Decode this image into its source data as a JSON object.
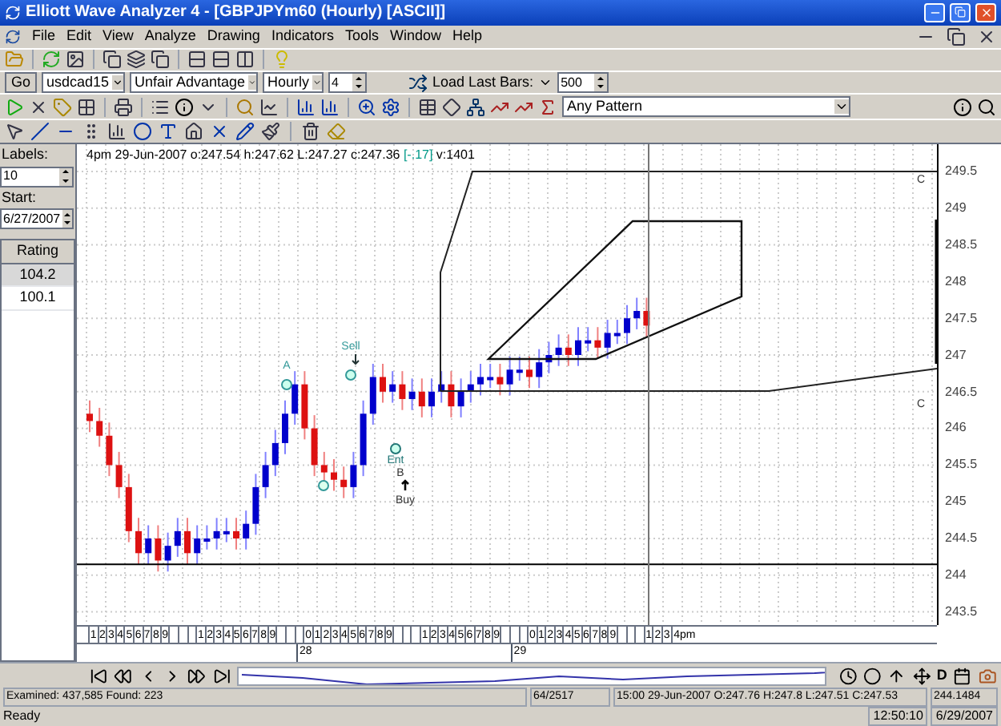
{
  "window": {
    "title": "Elliott Wave Analyzer 4 - [GBPJPYm60 (Hourly) [ASCII]]"
  },
  "menu": [
    "File",
    "Edit",
    "View",
    "Analyze",
    "Drawing",
    "Indicators",
    "Tools",
    "Window",
    "Help"
  ],
  "symbol_bar": {
    "go": "Go",
    "symbol": "usdcad15",
    "pattern_set": "Unfair Advantage",
    "timeframe": "Hourly",
    "count": "4",
    "load_label": "Load Last Bars:",
    "bars": "500"
  },
  "pattern_select": "Any Pattern",
  "side_panel": {
    "labels_label": "Labels:",
    "labels_value": "10",
    "start_label": "Start:",
    "start_value": "6/27/2007",
    "rating_header": "Rating",
    "ratings": [
      {
        "value": "104.2",
        "selected": true
      },
      {
        "value": "100.1",
        "selected": false
      }
    ]
  },
  "chart": {
    "info": "4pm 29-Jun-2007  o:247.54 h:247.62 L:247.27 c:247.36",
    "change": "[-.17]",
    "volume": "v:1401",
    "price_ticks": [
      "249.5",
      "249",
      "248.5",
      "248",
      "247.5",
      "247",
      "246.5",
      "246",
      "245.5",
      "245",
      "244.5",
      "244",
      "243.5"
    ],
    "markers": [
      {
        "kind": "top",
        "label": "A"
      },
      {
        "kind": "top",
        "label": "Sell"
      },
      {
        "kind": "bottom"
      },
      {
        "kind": "entry",
        "label": "Ent"
      }
    ],
    "entry_wave": "B",
    "signal": "Buy",
    "channel_labels": [
      "C",
      "C"
    ]
  },
  "time_axis": {
    "groups": [
      [
        "1",
        "2",
        "3",
        "4",
        "5",
        "6",
        "7",
        "8",
        "9"
      ],
      [
        "1",
        "2",
        "3",
        "4",
        "5",
        "6",
        "7",
        "8",
        "9"
      ],
      [
        "0",
        "1",
        "2",
        "3",
        "4",
        "5",
        "6",
        "7",
        "8",
        "9"
      ],
      [
        "1",
        "2",
        "3",
        "4",
        "5",
        "6",
        "7",
        "8",
        "9"
      ],
      [
        "0",
        "1",
        "2",
        "3",
        "4",
        "5",
        "6",
        "7",
        "8",
        "9"
      ],
      [
        "1",
        "2",
        "3"
      ]
    ],
    "current": "4pm",
    "days": [
      "28",
      "29"
    ]
  },
  "nav_letter": "D",
  "status": {
    "examined": "Examined: 437,585  Found: 223",
    "position": "64/2517",
    "bar": "15:00 29-Jun-2007  O:247.76 H:247.8 L:247.51 C:247.53",
    "cursor_price": "244.1484"
  },
  "status_bar": {
    "text": "Ready",
    "time": "12:50:10",
    "date": "6/29/2007"
  }
}
